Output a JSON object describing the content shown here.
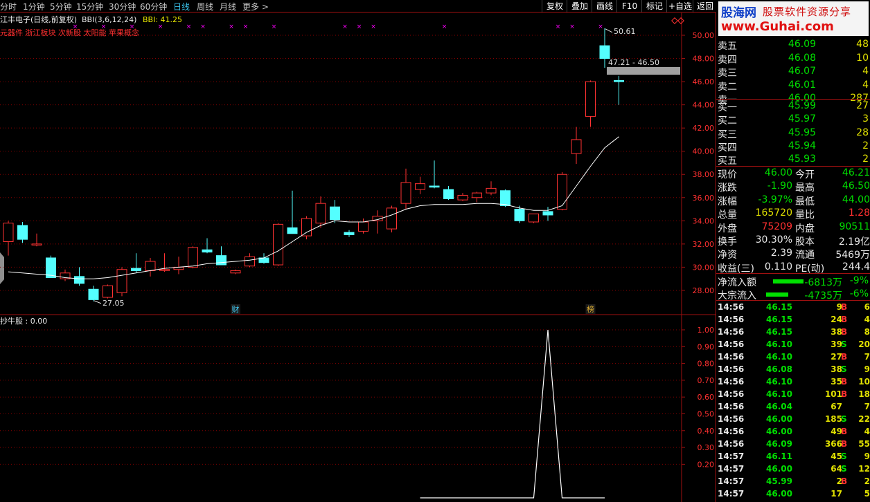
{
  "toolbar": {
    "periods": [
      "分时",
      "1分钟",
      "5分钟",
      "15分钟",
      "30分钟",
      "60分钟",
      "日线",
      "周线",
      "月线",
      "更多 >"
    ],
    "active_period": "日线",
    "buttons": [
      "复权",
      "叠加",
      "画线",
      "F10",
      "标记",
      "+自选",
      "返回"
    ]
  },
  "logo": {
    "name": "股海网",
    "slogan": "股票软件资源分享",
    "url": "www.Guhai.com"
  },
  "main_chart": {
    "header_prefix": "江丰电子(日线,前复权)",
    "indicator_label": "BBI(3,6,12,24)",
    "indicator_value": "BBI: 41.25",
    "concepts": "元器件 浙江板块 次新股 太阳能 苹果概念",
    "y_ticks": [
      "50.00",
      "48.00",
      "46.00",
      "44.00",
      "42.00",
      "40.00",
      "38.00",
      "36.00",
      "34.00",
      "32.00",
      "30.00",
      "28.00"
    ],
    "y_range": [
      27,
      51.5
    ],
    "annotations": {
      "high": "50.61",
      "low": "27.05",
      "price_range": "47.21 - 46.50"
    },
    "markers": [
      {
        "label": "财",
        "index": 16
      },
      {
        "label": "榜",
        "index": 41
      }
    ],
    "colors": {
      "up": "#ff3232",
      "down": "#54ffff",
      "bbi": "#ffffff",
      "grid": "#8b0000",
      "signal": "#ff00ff"
    }
  },
  "chart_data": [
    {
      "type": "candlestick",
      "title": "江丰电子(日线,前复权)",
      "series_names": [
        "K线",
        "BBI"
      ],
      "candles": [
        {
          "o": 32.2,
          "h": 34.0,
          "l": 31.0,
          "c": 33.8
        },
        {
          "o": 33.6,
          "h": 33.9,
          "l": 32.1,
          "c": 32.4
        },
        {
          "o": 32.0,
          "h": 32.9,
          "l": 31.8,
          "c": 32.0
        },
        {
          "o": 30.8,
          "h": 31.0,
          "l": 29.1,
          "c": 29.1
        },
        {
          "o": 29.0,
          "h": 29.8,
          "l": 28.8,
          "c": 29.5
        },
        {
          "o": 29.2,
          "h": 30.0,
          "l": 28.4,
          "c": 28.6
        },
        {
          "o": 28.1,
          "h": 28.4,
          "l": 27.05,
          "c": 27.2
        },
        {
          "o": 27.4,
          "h": 28.5,
          "l": 27.3,
          "c": 28.4
        },
        {
          "o": 27.8,
          "h": 30.0,
          "l": 27.5,
          "c": 29.8
        },
        {
          "o": 29.9,
          "h": 31.2,
          "l": 29.5,
          "c": 29.7
        },
        {
          "o": 29.7,
          "h": 30.8,
          "l": 29.2,
          "c": 30.5
        },
        {
          "o": 29.8,
          "h": 31.2,
          "l": 29.6,
          "c": 29.8
        },
        {
          "o": 29.8,
          "h": 30.9,
          "l": 29.4,
          "c": 30.0
        },
        {
          "o": 30.0,
          "h": 31.8,
          "l": 29.9,
          "c": 31.7
        },
        {
          "o": 31.5,
          "h": 32.5,
          "l": 31.2,
          "c": 31.3
        },
        {
          "o": 31.0,
          "h": 31.8,
          "l": 30.2,
          "c": 30.2
        },
        {
          "o": 29.5,
          "h": 29.8,
          "l": 29.4,
          "c": 29.7
        },
        {
          "o": 30.1,
          "h": 31.2,
          "l": 30.0,
          "c": 30.9
        },
        {
          "o": 30.8,
          "h": 31.2,
          "l": 30.3,
          "c": 30.4
        },
        {
          "o": 30.2,
          "h": 33.8,
          "l": 30.1,
          "c": 33.7
        },
        {
          "o": 33.4,
          "h": 36.6,
          "l": 33.0,
          "c": 32.9
        },
        {
          "o": 32.7,
          "h": 34.4,
          "l": 32.4,
          "c": 34.2
        },
        {
          "o": 33.8,
          "h": 36.1,
          "l": 33.4,
          "c": 35.5
        },
        {
          "o": 35.2,
          "h": 35.8,
          "l": 33.8,
          "c": 34.1
        },
        {
          "o": 33.0,
          "h": 33.2,
          "l": 32.6,
          "c": 32.8
        },
        {
          "o": 33.1,
          "h": 34.2,
          "l": 32.9,
          "c": 33.9
        },
        {
          "o": 34.0,
          "h": 34.9,
          "l": 32.9,
          "c": 34.4
        },
        {
          "o": 33.3,
          "h": 35.3,
          "l": 33.0,
          "c": 35.1
        },
        {
          "o": 35.5,
          "h": 38.5,
          "l": 35.0,
          "c": 37.3
        },
        {
          "o": 36.7,
          "h": 37.8,
          "l": 36.3,
          "c": 37.2
        },
        {
          "o": 37.0,
          "h": 39.2,
          "l": 36.8,
          "c": 36.9
        },
        {
          "o": 36.7,
          "h": 37.0,
          "l": 35.8,
          "c": 35.9
        },
        {
          "o": 35.8,
          "h": 36.4,
          "l": 35.7,
          "c": 36.2
        },
        {
          "o": 36.0,
          "h": 36.5,
          "l": 35.6,
          "c": 36.4
        },
        {
          "o": 36.4,
          "h": 37.4,
          "l": 36.2,
          "c": 36.8
        },
        {
          "o": 36.6,
          "h": 36.7,
          "l": 35.2,
          "c": 35.3
        },
        {
          "o": 35.0,
          "h": 35.3,
          "l": 33.8,
          "c": 34.0
        },
        {
          "o": 33.9,
          "h": 34.6,
          "l": 33.8,
          "c": 34.6
        },
        {
          "o": 34.8,
          "h": 35.2,
          "l": 34.0,
          "c": 34.5
        },
        {
          "o": 35.0,
          "h": 38.2,
          "l": 34.9,
          "c": 38.0
        },
        {
          "o": 39.8,
          "h": 42.1,
          "l": 38.9,
          "c": 41.0
        },
        {
          "o": 43.0,
          "h": 46.1,
          "l": 42.1,
          "c": 46.0
        },
        {
          "o": 49.1,
          "h": 50.61,
          "l": 47.2,
          "c": 48.0
        },
        {
          "o": 46.1,
          "h": 46.5,
          "l": 44.0,
          "c": 46.0
        }
      ],
      "bbi": [
        29.6,
        29.5,
        29.4,
        29.3,
        29.1,
        29.0,
        29.0,
        29.1,
        29.3,
        29.5,
        29.7,
        29.9,
        30.0,
        30.1,
        30.3,
        30.4,
        30.5,
        30.6,
        30.8,
        31.4,
        32.2,
        33.0,
        33.6,
        34.0,
        33.9,
        33.9,
        34.1,
        34.5,
        35.0,
        35.3,
        35.4,
        35.4,
        35.4,
        35.5,
        35.5,
        35.4,
        35.1,
        34.9,
        34.9,
        35.3,
        37.0,
        38.7,
        40.3,
        41.25
      ],
      "x": [
        0,
        1,
        2,
        3,
        4,
        5,
        6,
        7,
        8,
        9,
        10,
        11,
        12,
        13,
        14,
        15,
        16,
        17,
        18,
        19,
        20,
        21,
        22,
        23,
        24,
        25,
        26,
        27,
        28,
        29,
        30,
        31,
        32,
        33,
        34,
        35,
        36,
        37,
        38,
        39,
        40,
        41,
        42,
        43
      ],
      "ylim": [
        27,
        51.5
      ]
    },
    {
      "type": "line",
      "title": "抄牛股 : 0.00",
      "series_names": [
        "抄牛股"
      ],
      "x": [
        29,
        30,
        31,
        32,
        33,
        34,
        35,
        36,
        37,
        38,
        39,
        40,
        41,
        42
      ],
      "values": [
        0,
        0,
        0,
        0,
        0,
        0,
        0,
        0,
        0,
        1,
        0,
        0,
        0,
        0
      ],
      "ylim": [
        0,
        1.05
      ],
      "y_ticks": [
        "1.00",
        "0.90",
        "0.80",
        "0.70",
        "0.60",
        "0.50",
        "0.40",
        "0.30",
        "0.20"
      ]
    }
  ],
  "sub_chart": {
    "label": "抄牛股 : 0.00"
  },
  "quotes": {
    "asks": [
      {
        "label": "卖五",
        "price": "46.09",
        "vol": "48"
      },
      {
        "label": "卖四",
        "price": "46.08",
        "vol": "10"
      },
      {
        "label": "卖三",
        "price": "46.07",
        "vol": "4"
      },
      {
        "label": "卖二",
        "price": "46.01",
        "vol": "4"
      },
      {
        "label": "卖一",
        "price": "46.00",
        "vol": "287"
      }
    ],
    "bids": [
      {
        "label": "买一",
        "price": "45.99",
        "vol": "27"
      },
      {
        "label": "买二",
        "price": "45.97",
        "vol": "3"
      },
      {
        "label": "买三",
        "price": "45.95",
        "vol": "28"
      },
      {
        "label": "买四",
        "price": "45.94",
        "vol": "2"
      },
      {
        "label": "买五",
        "price": "45.93",
        "vol": "2"
      }
    ],
    "stats": [
      {
        "l1": "现价",
        "v1": "46.00",
        "c1": "green",
        "l2": "今开",
        "v2": "46.21",
        "c2": "green"
      },
      {
        "l1": "涨跌",
        "v1": "-1.90",
        "c1": "green",
        "l2": "最高",
        "v2": "46.50",
        "c2": "green"
      },
      {
        "l1": "涨幅",
        "v1": "-3.97%",
        "c1": "green",
        "l2": "最低",
        "v2": "44.00",
        "c2": "green"
      },
      {
        "l1": "总量",
        "v1": "165720",
        "c1": "yellow",
        "l2": "量比",
        "v2": "1.28",
        "c2": "red"
      },
      {
        "l1": "外盘",
        "v1": "75209",
        "c1": "red",
        "l2": "内盘",
        "v2": "90511",
        "c2": "green"
      },
      {
        "l1": "换手",
        "v1": "30.30%",
        "c1": "white",
        "l2": "股本",
        "v2": "2.19亿",
        "c2": "white"
      },
      {
        "l1": "净资",
        "v1": "2.39",
        "c1": "white",
        "l2": "流通",
        "v2": "5469万",
        "c2": "white"
      },
      {
        "l1": "收益(三)",
        "v1": "0.110",
        "c1": "white",
        "l2": "PE(动)",
        "v2": "244.4",
        "c2": "white"
      }
    ],
    "flows": [
      {
        "label": "净流入额",
        "value": "-6813万",
        "pct": "-9%"
      },
      {
        "label": "大宗流入",
        "value": "-4735万",
        "pct": "-6%"
      }
    ],
    "ticks": [
      {
        "t": "14:56",
        "p": "46.15",
        "v": "9",
        "s": "B",
        "n": "6"
      },
      {
        "t": "14:56",
        "p": "46.15",
        "v": "24",
        "s": "B",
        "n": "4"
      },
      {
        "t": "14:56",
        "p": "46.15",
        "v": "38",
        "s": "B",
        "n": "8"
      },
      {
        "t": "14:56",
        "p": "46.10",
        "v": "39",
        "s": "S",
        "n": "20"
      },
      {
        "t": "14:56",
        "p": "46.10",
        "v": "27",
        "s": "B",
        "n": "7"
      },
      {
        "t": "14:56",
        "p": "46.08",
        "v": "38",
        "s": "S",
        "n": "9"
      },
      {
        "t": "14:56",
        "p": "46.10",
        "v": "35",
        "s": "B",
        "n": "10"
      },
      {
        "t": "14:56",
        "p": "46.10",
        "v": "101",
        "s": "B",
        "n": "18"
      },
      {
        "t": "14:56",
        "p": "46.04",
        "v": "67",
        "s": "",
        "n": "7"
      },
      {
        "t": "14:56",
        "p": "46.00",
        "v": "185",
        "s": "S",
        "n": "22"
      },
      {
        "t": "14:56",
        "p": "46.00",
        "v": "49",
        "s": "B",
        "n": "4"
      },
      {
        "t": "14:56",
        "p": "46.09",
        "v": "366",
        "s": "B",
        "n": "55"
      },
      {
        "t": "14:57",
        "p": "46.11",
        "v": "45",
        "s": "S",
        "n": "9"
      },
      {
        "t": "14:57",
        "p": "46.00",
        "v": "64",
        "s": "S",
        "n": "12"
      },
      {
        "t": "14:57",
        "p": "45.99",
        "v": "2",
        "s": "B",
        "n": "2"
      },
      {
        "t": "14:57",
        "p": "46.00",
        "v": "17",
        "s": "",
        "n": "5"
      }
    ]
  }
}
